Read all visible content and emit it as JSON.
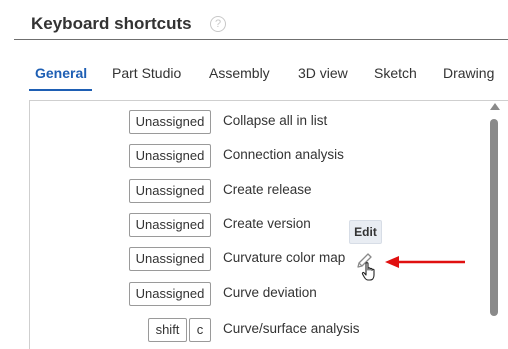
{
  "header": {
    "title": "Keyboard shortcuts",
    "help_glyph": "?"
  },
  "tabs": [
    {
      "label": "General",
      "active": true
    },
    {
      "label": "Part Studio"
    },
    {
      "label": "Assembly"
    },
    {
      "label": "3D view"
    },
    {
      "label": "Sketch"
    },
    {
      "label": "Drawing"
    }
  ],
  "shortcuts": [
    {
      "keys": [
        "Unassigned"
      ],
      "action": "Collapse all in list"
    },
    {
      "keys": [
        "Unassigned"
      ],
      "action": "Connection analysis"
    },
    {
      "keys": [
        "Unassigned"
      ],
      "action": "Create release"
    },
    {
      "keys": [
        "Unassigned"
      ],
      "action": "Create version"
    },
    {
      "keys": [
        "Unassigned"
      ],
      "action": "Curvature color map"
    },
    {
      "keys": [
        "Unassigned"
      ],
      "action": "Curve deviation"
    },
    {
      "keys": [
        "shift",
        "c"
      ],
      "action": "Curve/surface analysis"
    }
  ],
  "tooltip": {
    "label": "Edit"
  },
  "colors": {
    "accent": "#1e5fb4",
    "arrow": "#e01010",
    "tooltip_bg": "#e9edf3"
  },
  "icons": {
    "edit": "pencil-icon",
    "cursor": "hand-pointer-icon",
    "help": "question-circle-icon"
  }
}
